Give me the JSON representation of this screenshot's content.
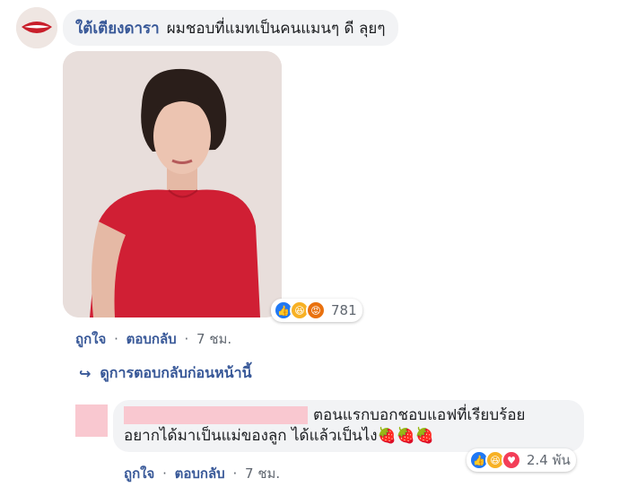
{
  "comment1": {
    "author": "ใต้เตียงดารา",
    "text": "ผมชอบที่แมทเป็นคนแมนๆ ดี ลุยๆ",
    "reaction_count": "781",
    "actions": {
      "like": "ถูกใจ",
      "reply": "ตอบกลับ",
      "time": "7 ชม."
    }
  },
  "view_previous": {
    "label": "ดูการตอบกลับก่อนหน้านี้"
  },
  "reply1": {
    "line1": "ตอนแรกบอกชอบแอฟที่เรียบร้อย",
    "line2": "อยากได้มาเป็นแม่ของลูก ได้แล้วเป็นไง",
    "emoji": "🍓🍓🍓",
    "reaction_count": "2.4 พัน",
    "actions": {
      "like": "ถูกใจ",
      "reply": "ตอบกลับ",
      "time": "7 ชม."
    }
  },
  "icons": {
    "comment1_reactions": [
      "like-icon",
      "haha-icon",
      "angry-icon"
    ],
    "reply1_reactions": [
      "like-icon",
      "haha-icon",
      "love-icon"
    ]
  },
  "colors": {
    "link": "#385898",
    "bubble": "#f2f3f5",
    "like": "#2078f4",
    "redaction": "#f9c8d0"
  }
}
